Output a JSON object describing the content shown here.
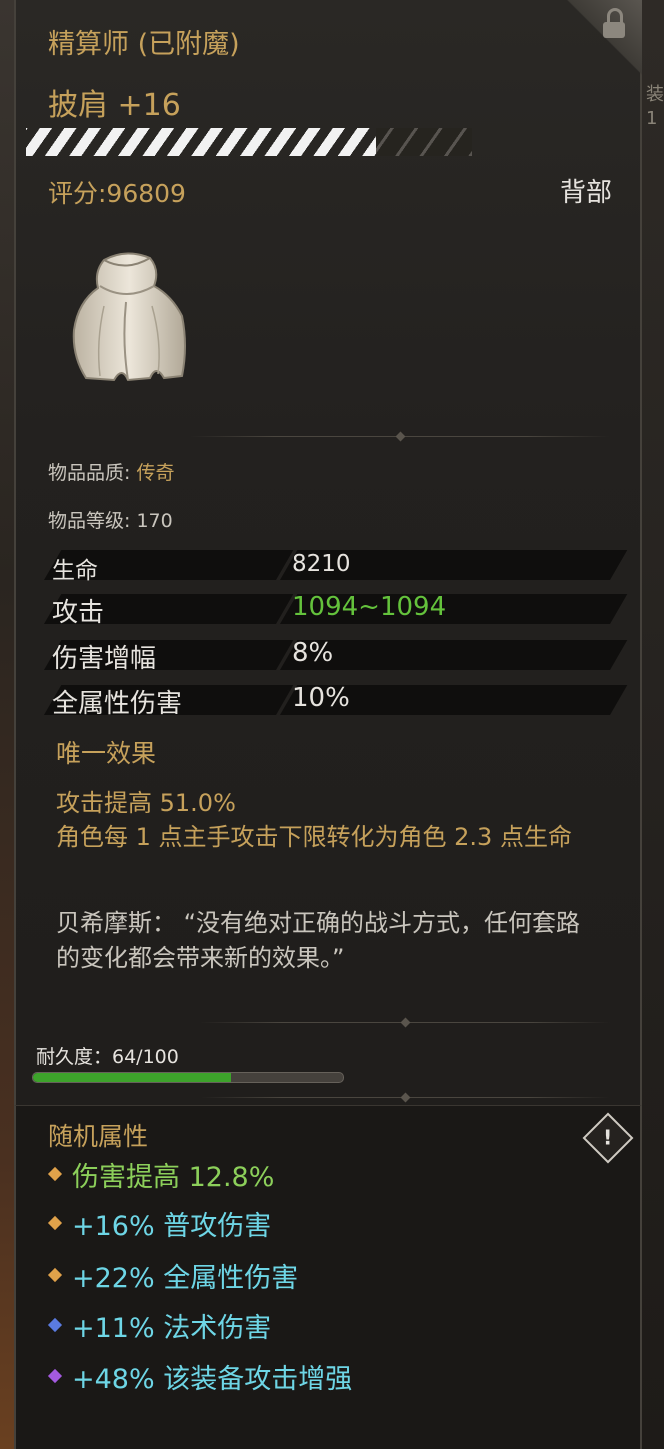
{
  "item": {
    "name": "精算师 (已附魔)",
    "slot_name": "披肩 +16",
    "score": "评分:96809",
    "slot": "背部",
    "quality_label": "物品品质: ",
    "quality_value": "传奇",
    "level": "物品等级: 170",
    "enhance_progress": 0.79,
    "icon": "cape-icon",
    "stats": [
      {
        "label": "生命",
        "value": "8210",
        "color": "#e6e3de"
      },
      {
        "label": "攻击",
        "value": "1094~1094",
        "color": "#64c23c"
      },
      {
        "label": "伤害增幅",
        "value": "8%",
        "color": "#e6e3de"
      },
      {
        "label": "全属性伤害",
        "value": "10%",
        "color": "#e6e3de"
      }
    ],
    "unique_title": "唯一效果",
    "unique_lines": [
      "攻击提高 51.0%",
      "角色每 1 点主手攻击下限转化为角色 2.3 点生命"
    ],
    "lore": "贝希摩斯： “没有绝对正确的战斗方式，任何套路的变化都会带来新的效果。”",
    "durability": "耐久度：64/100",
    "durability_fraction": 0.64,
    "random_title": "随机属性",
    "random_attrs": [
      {
        "text": "伤害提高 12.8%",
        "color": "#8ccf5a",
        "gem": "#e0a24a"
      },
      {
        "text": "+16% 普攻伤害",
        "color": "#6ed6e6",
        "gem": "#e0a24a"
      },
      {
        "text": "+22% 全属性伤害",
        "color": "#6ed6e6",
        "gem": "#e0a24a"
      },
      {
        "text": "+11% 法术伤害",
        "color": "#6ed6e6",
        "gem": "#5a7be0"
      },
      {
        "text": "+48% 该装备攻击增强",
        "color": "#6ed6e6",
        "gem": "#a45ae0"
      }
    ]
  },
  "colors": {
    "gold": "#c6a15b",
    "attack_green": "#64c23c",
    "durability_green": "#3da32b"
  }
}
